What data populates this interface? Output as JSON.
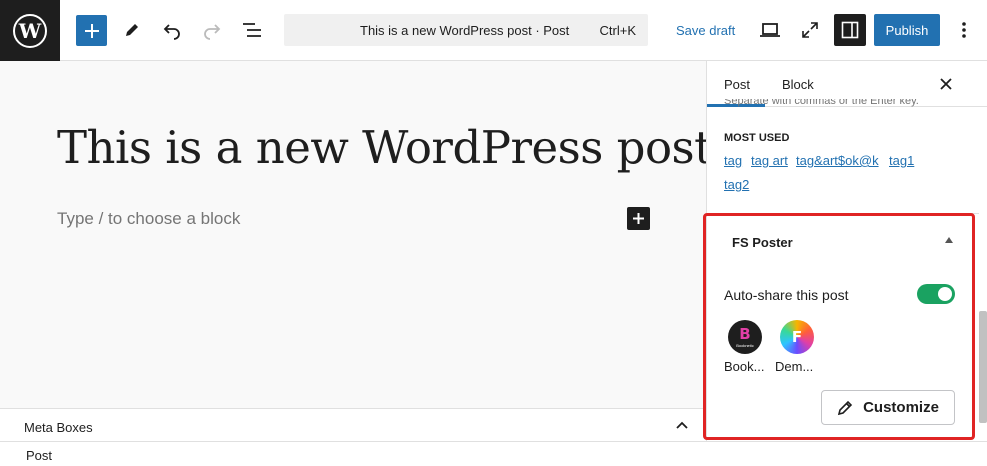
{
  "toolbar": {
    "logo_letter": "W",
    "command_title": "This is a new WordPress post · Post",
    "command_shortcut": "Ctrl+K",
    "save_draft": "Save draft",
    "publish": "Publish"
  },
  "editor": {
    "post_title": "This is a new WordPress post",
    "placeholder": "Type / to choose a block"
  },
  "footer": {
    "meta_boxes": "Meta Boxes",
    "breadcrumb": "Post"
  },
  "sidebar": {
    "tabs": [
      {
        "label": "Post",
        "active": true
      },
      {
        "label": "Block",
        "active": false
      }
    ],
    "tags_hint": "Separate with commas or the Enter key.",
    "most_used_heading": "MOST USED",
    "tags": [
      "tag",
      "tag art",
      "tag&art$ok@k",
      "tag1",
      "tag2"
    ],
    "fs_poster": {
      "title": "FS Poster",
      "auto_share_label": "Auto-share this post",
      "auto_share_enabled": true,
      "accounts": [
        {
          "name": "Book...",
          "avatar_text": "B",
          "avatar_sub": "Booknetic"
        },
        {
          "name": "Dem...",
          "avatar_text": "F"
        }
      ],
      "customize": "Customize"
    }
  },
  "colors": {
    "accent": "#2271b1",
    "toggle_on": "#1aa261",
    "highlight": "#e02424"
  }
}
